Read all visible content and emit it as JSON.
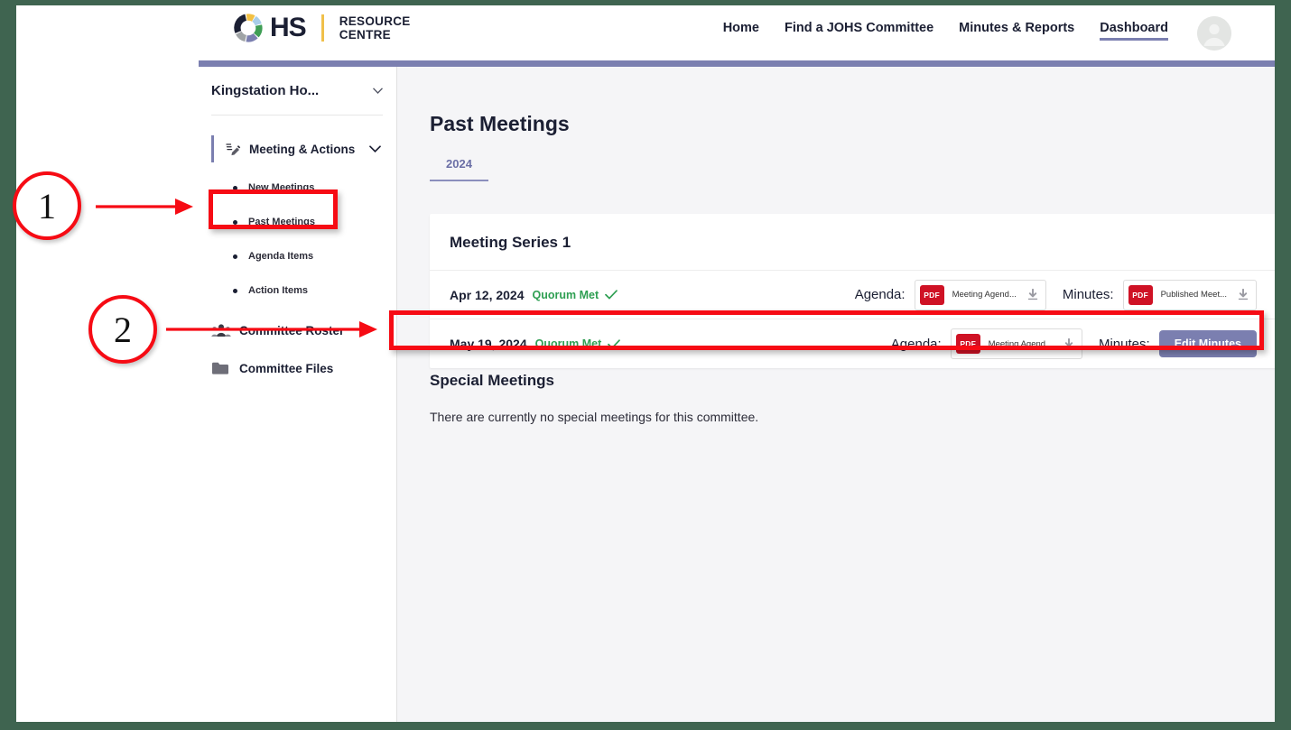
{
  "brand": {
    "logo_icon": "ohs-ring-icon",
    "hs_text": "HS",
    "line1": "RESOURCE",
    "line2": "CENTRE"
  },
  "topnav": {
    "items": [
      {
        "label": "Home",
        "active": false
      },
      {
        "label": "Find a JOHS Committee",
        "active": false
      },
      {
        "label": "Minutes & Reports",
        "active": false
      },
      {
        "label": "Dashboard",
        "active": true
      }
    ],
    "avatar_icon": "user-avatar-icon"
  },
  "sidebar": {
    "committee_selector": {
      "label": "Kingstation Ho...",
      "caret_icon": "caret-down-icon"
    },
    "meeting_actions": {
      "label": "Meeting & Actions",
      "icon": "meeting-actions-icon",
      "chevron_icon": "chevron-down-icon",
      "expanded": true,
      "subitems": [
        {
          "label": "New Meetings",
          "selected": false
        },
        {
          "label": "Past Meetings",
          "selected": true
        },
        {
          "label": "Agenda Items",
          "selected": false
        },
        {
          "label": "Action Items",
          "selected": false
        }
      ]
    },
    "links": [
      {
        "label": "Committee Roster",
        "icon": "people-group-icon"
      },
      {
        "label": "Committee Files",
        "icon": "folder-icon"
      }
    ]
  },
  "main": {
    "page_title": "Past Meetings",
    "tabs": [
      {
        "label": "2024",
        "active": true
      }
    ],
    "series": {
      "title": "Meeting Series 1",
      "rows": [
        {
          "date": "Apr 12, 2024",
          "quorum": "Quorum Met",
          "quorum_icon": "check-icon",
          "agenda_label": "Agenda:",
          "agenda_doc": {
            "badge": "PDF",
            "name": "Meeting Agend...",
            "download_icon": "download-icon"
          },
          "minutes_label": "Minutes:",
          "minutes_type": "doc",
          "minutes_doc": {
            "badge": "PDF",
            "name": "Published Meet...",
            "download_icon": "download-icon"
          }
        },
        {
          "date": "May 19, 2024",
          "quorum": "Quorum Met",
          "quorum_icon": "check-icon",
          "agenda_label": "Agenda:",
          "agenda_doc": {
            "badge": "PDF",
            "name": "Meeting Agend...",
            "download_icon": "download-icon"
          },
          "minutes_label": "Minutes:",
          "minutes_type": "button",
          "minutes_button": "Edit Minutes"
        }
      ]
    },
    "special": {
      "title": "Special Meetings",
      "empty_text": "There are currently no special meetings for this committee."
    }
  },
  "annotations": {
    "markers": [
      {
        "number": "1"
      },
      {
        "number": "2"
      }
    ],
    "color": "#f60b14"
  },
  "colors": {
    "accent_purple": "#7b7fb0",
    "pdf_red": "#cf1225",
    "quorum_green": "#2e9f52",
    "frame_green": "#3f6450",
    "content_bg": "#f5f5f7"
  }
}
